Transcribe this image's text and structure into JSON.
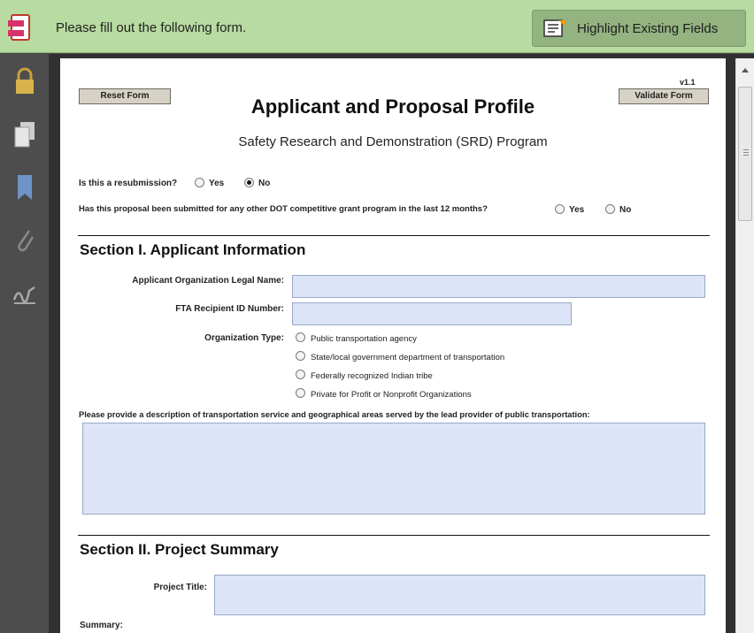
{
  "notification": {
    "message": "Please fill out the following form.",
    "highlight_button": "Highlight Existing Fields",
    "form_icon": "form-fields-icon",
    "highlight_icon": "highlight-fields-icon"
  },
  "left_nav": {
    "icons": [
      "lock-icon",
      "pages-icon",
      "bookmark-icon",
      "attachment-icon",
      "signature-icon"
    ]
  },
  "form": {
    "version": "v1.1",
    "reset_button": "Reset Form",
    "validate_button": "Validate Form",
    "title": "Applicant and Proposal Profile",
    "subtitle": "Safety Research and Demonstration (SRD) Program",
    "resubmission": {
      "question": "Is this a resubmission?",
      "yes": "Yes",
      "no": "No",
      "selected": "No"
    },
    "other_dot": {
      "question": "Has this proposal been submitted for any other DOT competitive grant program in the last 12 months?",
      "yes": "Yes",
      "no": "No",
      "selected": ""
    },
    "section1": {
      "heading": "Section I. Applicant Information",
      "legal_name_label": "Applicant Organization Legal Name:",
      "legal_name_value": "",
      "recipient_id_label": "FTA Recipient ID Number:",
      "recipient_id_value": "",
      "org_type_label": "Organization Type:",
      "org_type_options": [
        "Public transportation agency",
        "State/local government department of transportation",
        "Federally recognized Indian tribe",
        "Private for Profit or Nonprofit Organizations"
      ],
      "description_label": "Please provide a description of transportation service and geographical areas served by the lead provider of public transportation:",
      "description_value": ""
    },
    "section2": {
      "heading": "Section II. Project Summary",
      "project_title_label": "Project Title:",
      "project_title_value": "",
      "summary_label": "Summary:"
    }
  },
  "colors": {
    "notification_bg": "#b7dba0",
    "field_bg": "#dde4f7",
    "nav_bg": "#4d4d4d"
  }
}
